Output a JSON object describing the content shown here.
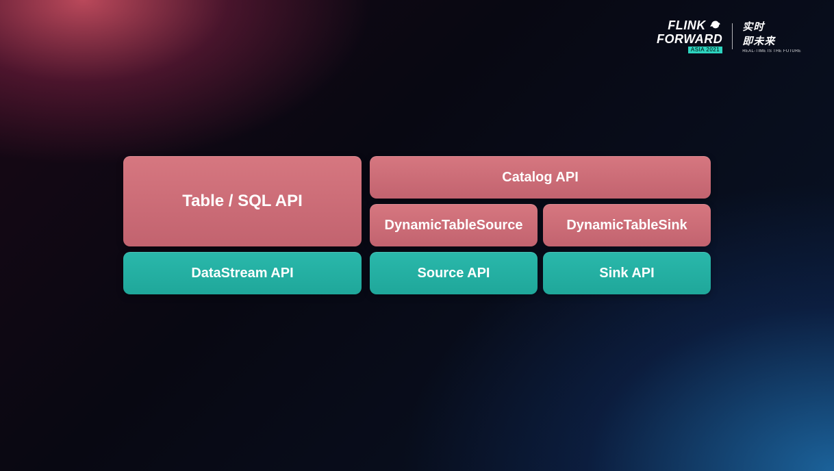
{
  "logo": {
    "line1": "FLINK",
    "line2": "FORWARD",
    "sub": "ASIA 2021",
    "cn_line1": "实时",
    "cn_line2": "即未来",
    "cn_sub": "REAL-TIME IS THE FUTURE"
  },
  "diagram": {
    "left": {
      "top": "Table / SQL API",
      "bottom": "DataStream API"
    },
    "right": {
      "top": "Catalog API",
      "mid_left": "DynamicTableSource",
      "mid_right": "DynamicTableSink",
      "bot_left": "Source API",
      "bot_right": "Sink API"
    }
  }
}
